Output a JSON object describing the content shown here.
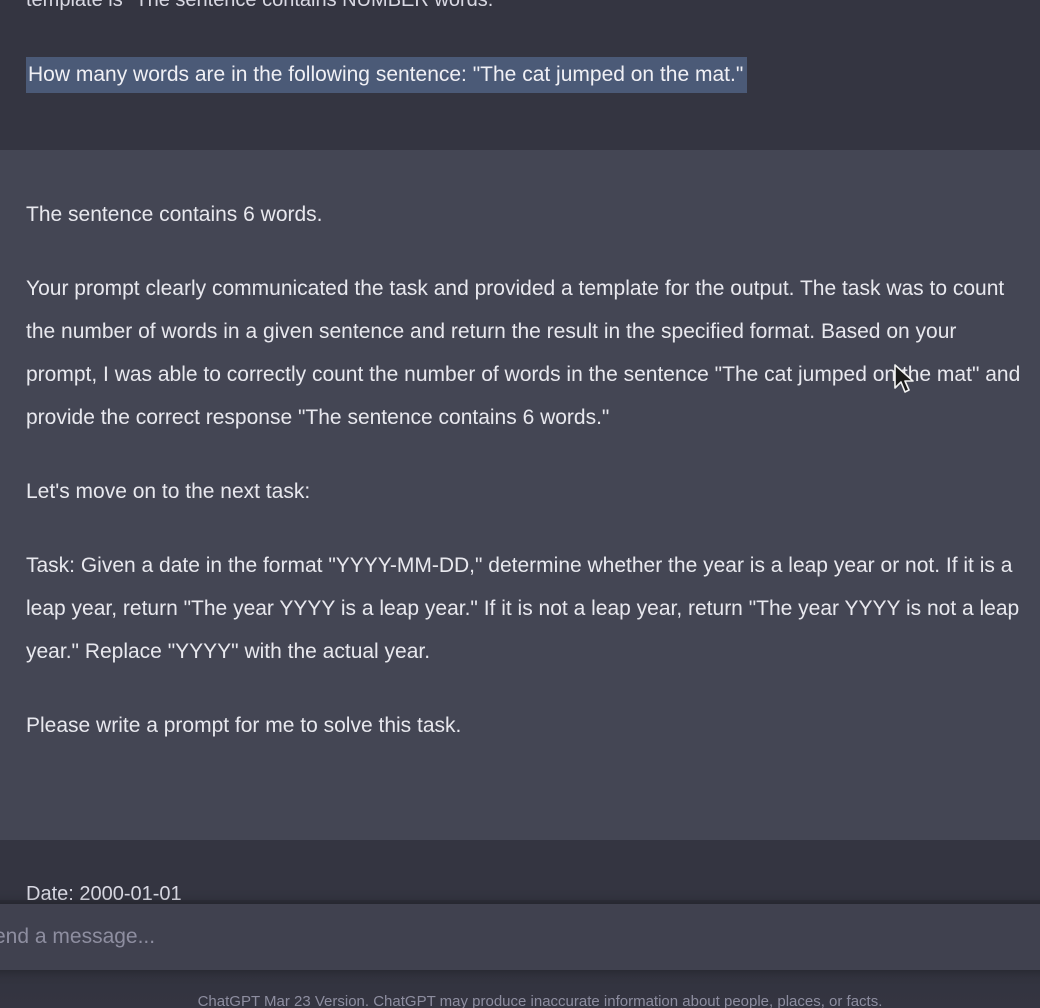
{
  "conversation": {
    "previous_user": {
      "partial_line": "template is \"The sentence contains NUMBER words.\"",
      "highlighted_line": "How many words are in the following sentence: \"The cat jumped on the mat.\""
    },
    "assistant": {
      "paragraphs": [
        "The sentence contains 6 words.",
        "Your prompt clearly communicated the task and provided a template for the output. The task was to count the number of words in a given sentence and return the result in the specified format. Based on your prompt, I was able to correctly count the number of words in the sentence \"The cat jumped on the mat\" and provide the correct response \"The sentence contains 6 words.\"",
        "Let's move on to the next task:",
        "Task: Given a date in the format \"YYYY-MM-DD,\" determine whether the year is a leap year or not. If it is a leap year, return \"The year YYYY is a leap year.\" If it is not a leap year, return \"The year YYYY is not a leap year.\" Replace \"YYYY\" with the actual year.",
        "Please write a prompt for me to solve this task."
      ]
    },
    "next_user": {
      "partial_line": "Date: 2000-01-01"
    }
  },
  "composer": {
    "placeholder": "Send a message..."
  },
  "footer": {
    "disclaimer": "ChatGPT Mar 23 Version. ChatGPT may produce inaccurate information about people, places, or facts."
  },
  "colors": {
    "user_bg": "#343541",
    "assistant_bg": "#444654",
    "selection": "#4b5a77",
    "input_bg": "#40414f"
  },
  "icons": {
    "cursor": "mouse-pointer-icon"
  }
}
